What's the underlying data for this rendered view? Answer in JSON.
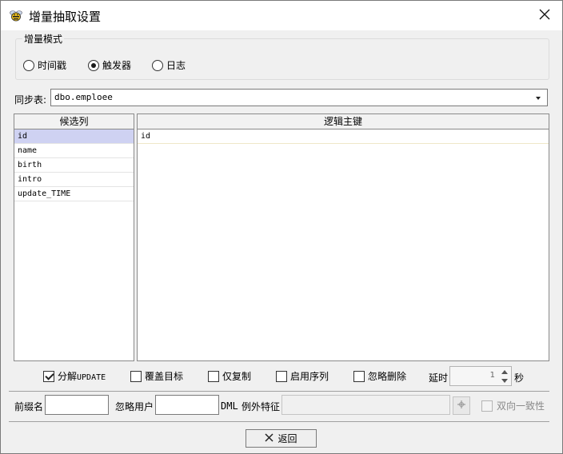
{
  "window": {
    "title": "增量抽取设置"
  },
  "mode_group": {
    "legend": "增量模式",
    "options": [
      {
        "label": "时间戳",
        "selected": false
      },
      {
        "label": "触发器",
        "selected": true
      },
      {
        "label": "日志",
        "selected": false
      }
    ]
  },
  "sync_table": {
    "label": "同步表:",
    "value": "dbo.emploee"
  },
  "candidates": {
    "header": "候选列",
    "items": [
      "id",
      "name",
      "birth",
      "intro",
      "update_TIME"
    ],
    "selected_index": 0
  },
  "logical_key": {
    "header": "逻辑主键",
    "items": [
      "id"
    ]
  },
  "options": {
    "split_update": {
      "label_prefix": "分解",
      "label_suffix": "UPDATE",
      "checked": true
    },
    "overwrite_target": {
      "label": "覆盖目标",
      "checked": false
    },
    "copy_only": {
      "label": "仅复制",
      "checked": false
    },
    "enable_sequence": {
      "label": "启用序列",
      "checked": false
    },
    "ignore_delete": {
      "label": "忽略删除",
      "checked": false
    },
    "delay": {
      "label": "延时",
      "value": "1",
      "unit": "秒"
    }
  },
  "bottom": {
    "prefix_label": "前缀名",
    "prefix_value": "",
    "ignore_user_label": "忽略用户",
    "ignore_user_value": "",
    "dml_label": "DML",
    "exception_label": "例外特征",
    "exception_value": "",
    "bidirectional_label": "双向一致性",
    "bidirectional_checked": false
  },
  "back_button": {
    "label": "返回"
  },
  "icons": {
    "app": "bee-icon",
    "close": "close-icon",
    "back": "x-icon"
  }
}
